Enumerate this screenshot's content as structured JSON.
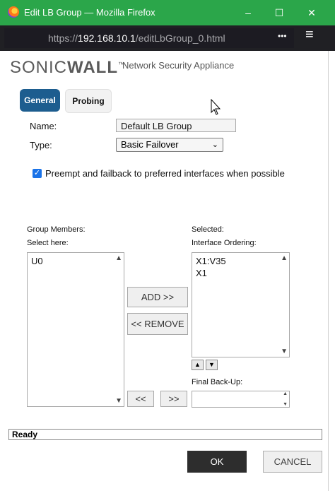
{
  "window": {
    "title": "Edit LB Group — Mozilla Firefox",
    "minimize": "–",
    "maximize": "☐",
    "close": "✕"
  },
  "urlbar": {
    "prefix": "https://",
    "host": "192.168.10.1",
    "path": "/editLbGroup_0.html",
    "menu": "•••",
    "hamburger": "≡"
  },
  "brand": {
    "logo_a": "SONIC",
    "logo_b": "WALL",
    "tm": "™",
    "tagline": "Network Security Appliance"
  },
  "tabs": [
    {
      "label": "General",
      "active": true
    },
    {
      "label": "Probing",
      "active": false
    }
  ],
  "form": {
    "name_label": "Name:",
    "name_value": "Default LB Group",
    "type_label": "Type:",
    "type_value": "Basic Failover",
    "preempt_label": "Preempt and failback to preferred interfaces when possible",
    "preempt_checked": true
  },
  "members": {
    "group_members_label": "Group Members:",
    "select_here_label": "Select here:",
    "available": [
      "U0"
    ],
    "selected_label": "Selected:",
    "ordering_label": "Interface Ordering:",
    "selected": [
      "X1:V35",
      "X1"
    ],
    "add_button": "ADD >>",
    "remove_button": "<< REMOVE",
    "move_left": "<<",
    "move_right": ">>",
    "final_backup_label": "Final Back-Up:",
    "up_arrow": "▲",
    "down_arrow": "▼"
  },
  "status": "Ready",
  "buttons": {
    "ok": "OK",
    "cancel": "CANCEL"
  },
  "colors": {
    "titlebar": "#2ba64a",
    "urlbar": "#202024",
    "tab_active": "#1d5d8f",
    "ok_button": "#2d2d2d",
    "checkbox": "#1a73e8"
  }
}
